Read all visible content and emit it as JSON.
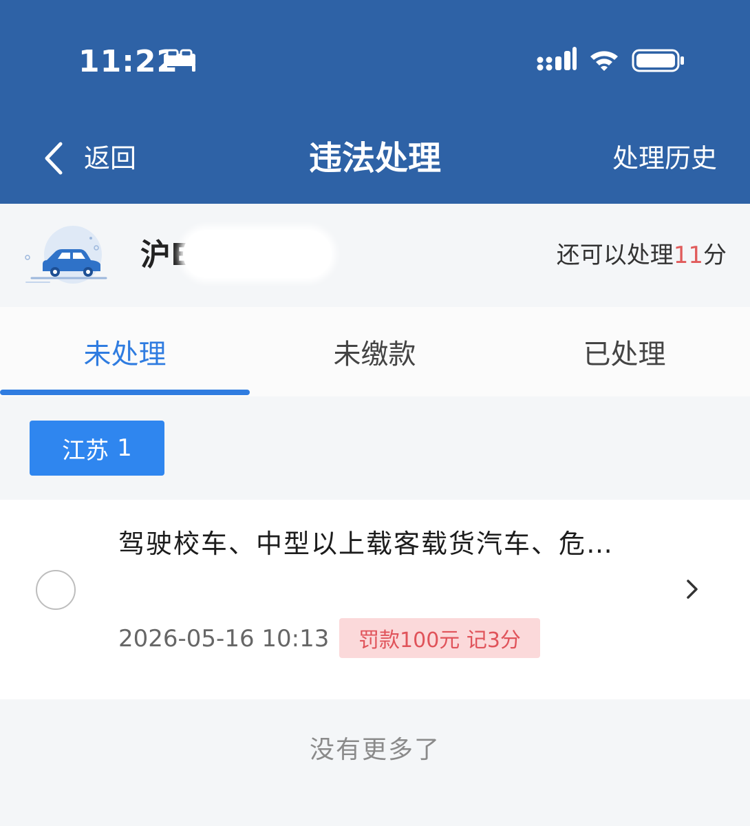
{
  "status_bar": {
    "time": "11:22"
  },
  "nav": {
    "back_label": "返回",
    "title": "违法处理",
    "history_label": "处理历史"
  },
  "vehicle": {
    "plate_prefix": "沪E",
    "points_prefix": "还可以处理",
    "points_value": "11",
    "points_suffix": "分"
  },
  "tabs": [
    {
      "label": "未处理",
      "active": true
    },
    {
      "label": "未缴款",
      "active": false
    },
    {
      "label": "已处理",
      "active": false
    }
  ],
  "region_filter": {
    "label": "江苏",
    "count": "1"
  },
  "violations": [
    {
      "title": "驾驶校车、中型以上载客载货汽车、危…",
      "time": "2026-05-16 10:13",
      "penalty": "罚款100元 记3分"
    }
  ],
  "footer": {
    "no_more_text": "没有更多了"
  },
  "colors": {
    "header_bg": "#2e62a6",
    "accent": "#2f7ce0",
    "chip_bg": "#2f86ef",
    "penalty_bg": "#fbd9da",
    "penalty_text": "#e0535a",
    "points_highlight": "#e05b5b"
  },
  "icons": [
    "bed-icon",
    "signal-icon",
    "wifi-icon",
    "battery-icon",
    "back-chevron-icon",
    "car-icon",
    "chevron-right-icon"
  ]
}
